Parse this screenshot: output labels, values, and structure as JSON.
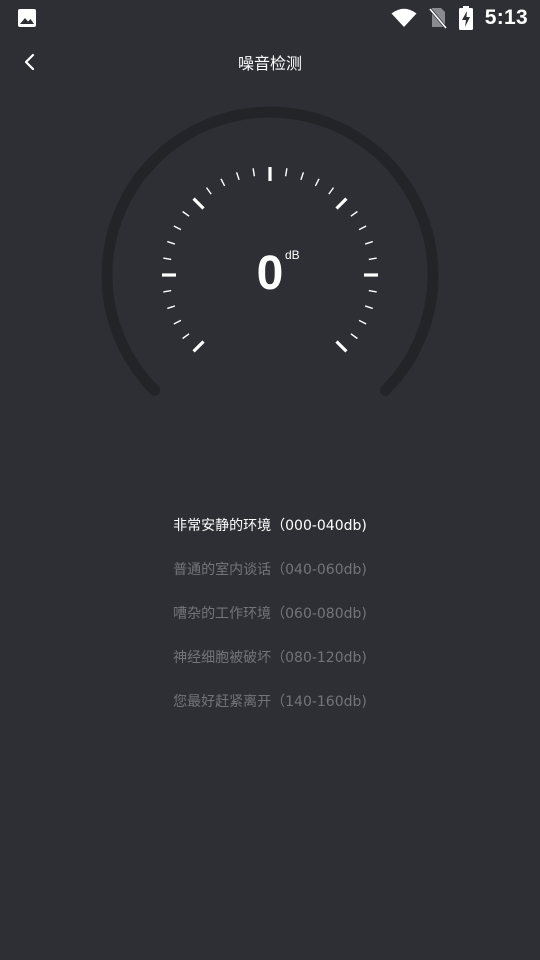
{
  "status_bar": {
    "time": "5:13",
    "left_icon": "image-icon",
    "icons": [
      "wifi-icon",
      "no-sim-icon",
      "battery-charging-icon"
    ]
  },
  "header": {
    "title": "噪音检测",
    "back_icon": "chevron-left-icon"
  },
  "meter": {
    "value": "0",
    "unit": "dB"
  },
  "levels": [
    {
      "label": "非常安静的环境（000-040db)",
      "active": true
    },
    {
      "label": "普通的室内谈话（040-060db)",
      "active": false
    },
    {
      "label": "嘈杂的工作环境（060-080db)",
      "active": false
    },
    {
      "label": "神经细胞被破坏（080-120db)",
      "active": false
    },
    {
      "label": "您最好赶紧离开（140-160db)",
      "active": false
    }
  ],
  "colors": {
    "background": "#2e2f34",
    "gauge_track": "#232428",
    "active_text": "#ffffff",
    "inactive_text": "#72747b"
  }
}
